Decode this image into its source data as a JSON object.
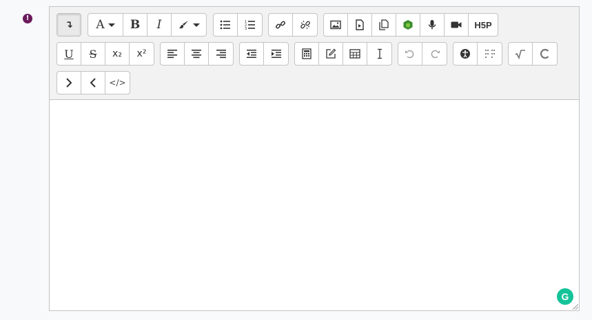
{
  "required_icon_glyph": "!",
  "toolbar": {
    "row1": {
      "collapse": {
        "icon": "collapse-arrow-icon",
        "glyph": "↴"
      },
      "font_label": "A",
      "bold_label": "B",
      "italic_label": "I",
      "color_icon": "brush-icon",
      "bullet_list_icon": "unordered-list-icon",
      "numbered_list_icon": "ordered-list-icon",
      "link_icon": "link-icon",
      "unlink_icon": "unlink-icon",
      "image_icon": "image-icon",
      "media_icon": "media-file-icon",
      "manage_files_icon": "manage-files-icon",
      "wiris_icon": "green-hexagon-icon",
      "record_audio_icon": "microphone-icon",
      "record_video_icon": "video-camera-icon",
      "h5p_label": "H5P"
    },
    "row2": {
      "underline_label": "U",
      "strike_label": "S",
      "subscript_label": "x₂",
      "superscript_label": "x²",
      "align_icons": [
        "align-left-icon",
        "align-center-icon",
        "align-right-icon"
      ],
      "indent_icons": [
        "outdent-icon",
        "indent-icon"
      ],
      "equation_icon": "calculator-icon",
      "edit_icon": "edit-square-icon",
      "table_icon": "table-icon",
      "cursor_icon": "text-cursor-icon",
      "undo_icon": "undo-icon",
      "redo_icon": "redo-icon",
      "accessibility_icon": "accessibility-icon",
      "braille_icon": "braille-dots-icon",
      "math_sqrt_icon": "sqrt-icon",
      "chem_icon": "chemistry-c-icon"
    },
    "row3": {
      "next_icon": "chevron-right-icon",
      "prev_icon": "chevron-left-icon",
      "html_icon": "code-icon",
      "html_label": "</>"
    }
  },
  "content": {
    "text": ""
  },
  "grammarly_label": "G",
  "colors": {
    "accent": "#6a1b5c",
    "grammarly": "#15c39a",
    "border": "#c3c3c3",
    "toolbar_bg": "#f2f2f2"
  }
}
